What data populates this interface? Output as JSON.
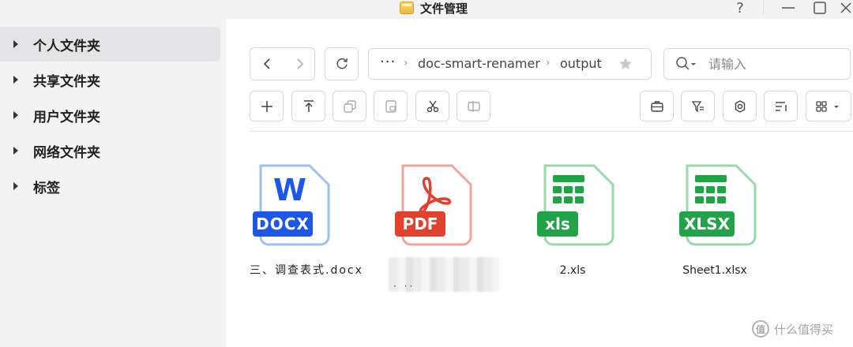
{
  "window": {
    "title": "文件管理",
    "help_label": "?"
  },
  "sidebar": {
    "items": [
      {
        "label": "个人文件夹"
      },
      {
        "label": "共享文件夹"
      },
      {
        "label": "用户文件夹"
      },
      {
        "label": "网络文件夹"
      },
      {
        "label": "标签"
      }
    ]
  },
  "path": {
    "more": "···",
    "segments": [
      "doc-smart-renamer",
      "output"
    ]
  },
  "search": {
    "placeholder": "请输入"
  },
  "files": [
    {
      "name": "三、调查表式.docx",
      "type_label": "DOCX",
      "glyph": "W",
      "color": "#1b57e8",
      "light": "#9cc0f2"
    },
    {
      "name": "",
      "type_label": "PDF",
      "color": "#e2412e",
      "light": "#f0a49a"
    },
    {
      "name": "2.xls",
      "type_label": "xls",
      "color": "#21a447",
      "light": "#9bd8a8"
    },
    {
      "name": "Sheet1.xlsx",
      "type_label": "XLSX",
      "color": "#21a447",
      "light": "#9bd8a8"
    }
  ],
  "watermark": {
    "icon": "值",
    "text": "什么值得买"
  }
}
